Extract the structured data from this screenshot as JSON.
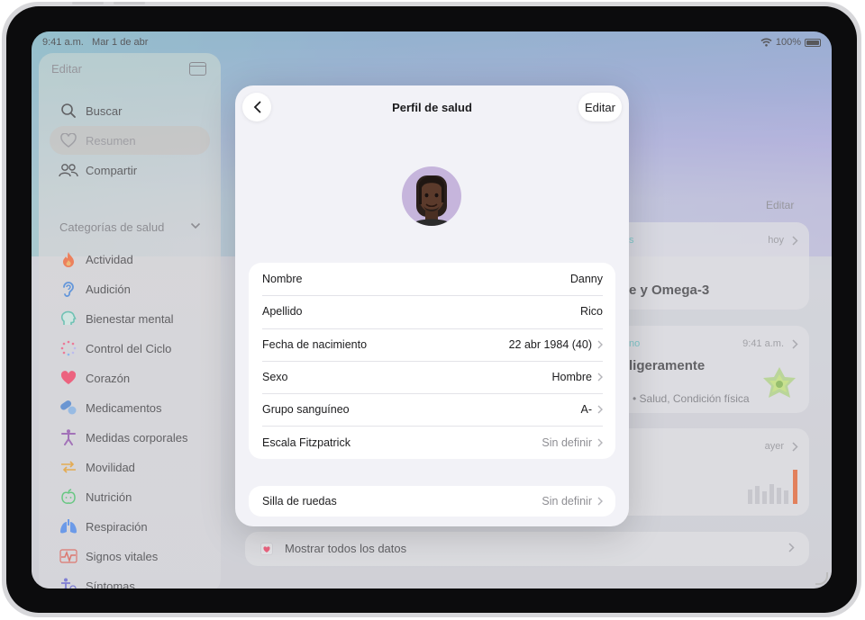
{
  "status": {
    "time": "9:41 a.m.",
    "date": "Mar 1 de abr",
    "battery": "100%"
  },
  "sidebar": {
    "edit_label": "Editar",
    "top_items": [
      {
        "label": "Buscar",
        "icon": "search-icon"
      },
      {
        "label": "Resumen",
        "icon": "heart-outline-icon"
      },
      {
        "label": "Compartir",
        "icon": "people-icon"
      }
    ],
    "section_title": "Categorías de salud",
    "categories": [
      {
        "label": "Actividad",
        "icon": "flame-icon",
        "color": "#ff5a1f"
      },
      {
        "label": "Audición",
        "icon": "ear-icon",
        "color": "#2f7de1"
      },
      {
        "label": "Bienestar mental",
        "icon": "head-icon",
        "color": "#3fbfa6"
      },
      {
        "label": "Control del Ciclo",
        "icon": "cycle-icon",
        "color": "#ff4f7a"
      },
      {
        "label": "Corazón",
        "icon": "heart-icon",
        "color": "#ff2d55"
      },
      {
        "label": "Medicamentos",
        "icon": "pills-icon",
        "color": "#3a7bd5"
      },
      {
        "label": "Medidas corporales",
        "icon": "body-icon",
        "color": "#8e44ad"
      },
      {
        "label": "Movilidad",
        "icon": "arrows-icon",
        "color": "#f39c12"
      },
      {
        "label": "Nutrición",
        "icon": "apple-icon",
        "color": "#34c759"
      },
      {
        "label": "Respiración",
        "icon": "lungs-icon",
        "color": "#3b82f6"
      },
      {
        "label": "Signos vitales",
        "icon": "pulse-icon",
        "color": "#e74c3c"
      },
      {
        "label": "Síntomas",
        "icon": "figure-icon",
        "color": "#5856d6"
      }
    ]
  },
  "background": {
    "edit_label": "Editar",
    "card1": {
      "accent": "s",
      "meta": "hoy",
      "title": "e y Omega-3"
    },
    "card2": {
      "accent": "no",
      "meta": "9:41 a.m.",
      "title": "ligeramente",
      "sub": "• Salud, Condición física"
    },
    "card3": {
      "meta": "ayer"
    },
    "show_all_label": "Mostrar todos los datos"
  },
  "modal": {
    "title": "Perfil de salud",
    "edit_label": "Editar",
    "rows": [
      {
        "label": "Nombre",
        "value": "Danny",
        "chevron": false,
        "muted": false
      },
      {
        "label": "Apellido",
        "value": "Rico",
        "chevron": false,
        "muted": false
      },
      {
        "label": "Fecha de nacimiento",
        "value": "22 abr 1984 (40)",
        "chevron": true,
        "muted": false
      },
      {
        "label": "Sexo",
        "value": "Hombre",
        "chevron": true,
        "muted": false
      },
      {
        "label": "Grupo sanguíneo",
        "value": "A-",
        "chevron": true,
        "muted": false
      },
      {
        "label": "Escala Fitzpatrick",
        "value": "Sin definir",
        "chevron": true,
        "muted": true
      }
    ],
    "wheelchair": {
      "label": "Silla de ruedas",
      "value": "Sin definir"
    }
  }
}
